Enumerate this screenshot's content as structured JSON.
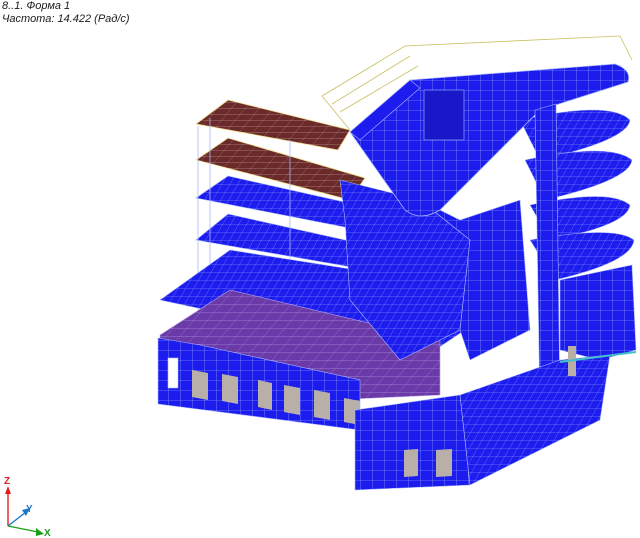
{
  "info": {
    "mode_line": "8..1. Форма 1",
    "frequency_line": "Частота: 14.422 (Рад/с)"
  },
  "triad": {
    "z_label": "Z",
    "y_label": "Y",
    "x_label": "X",
    "z_color": "#e02020",
    "y_color": "#1a78c8",
    "x_color": "#18a018"
  },
  "colors": {
    "mesh_blue": "#1c1cee",
    "mesh_line": "#a8b8ff",
    "slab_brown": "#6b2a2a",
    "slab_purple": "#6a3aa8",
    "opening_grey": "#b8b0a8",
    "undeformed_line": "#c8c060",
    "highlight_cyan": "#40c0c8"
  }
}
